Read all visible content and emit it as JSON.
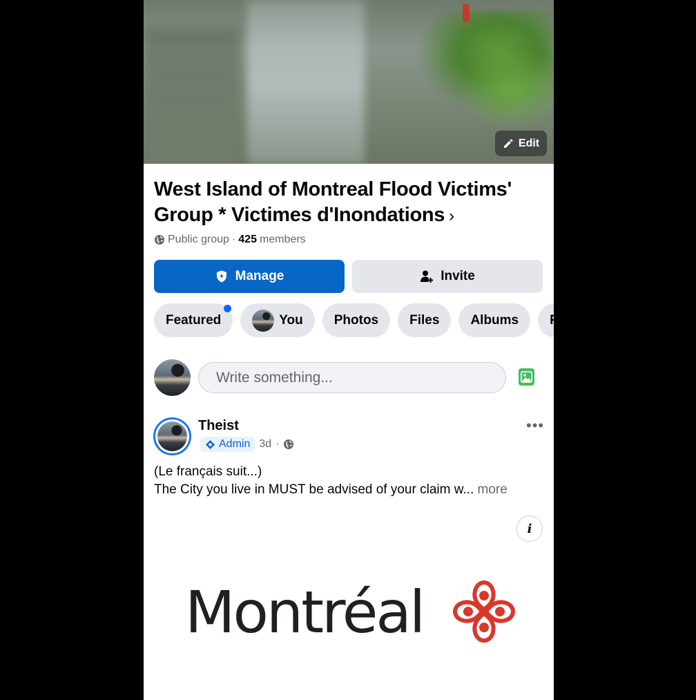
{
  "cover": {
    "edit_label": "Edit"
  },
  "group": {
    "title": "West Island of Montreal Flood Victims' Group * Victimes d'Inondations",
    "privacy": "Public group",
    "separator": "·",
    "member_count": "425",
    "members_label": "members"
  },
  "actions": {
    "manage_label": "Manage",
    "invite_label": "Invite"
  },
  "tabs": [
    {
      "label": "Featured",
      "has_notification_dot": true
    },
    {
      "label": "You"
    },
    {
      "label": "Photos"
    },
    {
      "label": "Files"
    },
    {
      "label": "Albums"
    },
    {
      "label": "Re"
    }
  ],
  "composer": {
    "placeholder": "Write something..."
  },
  "post": {
    "author": "Theist",
    "role": "Admin",
    "time": "3d",
    "separator": "·",
    "line1": "(Le français suit...)",
    "line2": "The City you live in MUST be advised of your claim w...",
    "more_label": "more",
    "info_label": "i",
    "image_logo_text": "Montréal"
  },
  "colors": {
    "accent": "#0866c6",
    "logo_red": "#d8382b"
  }
}
